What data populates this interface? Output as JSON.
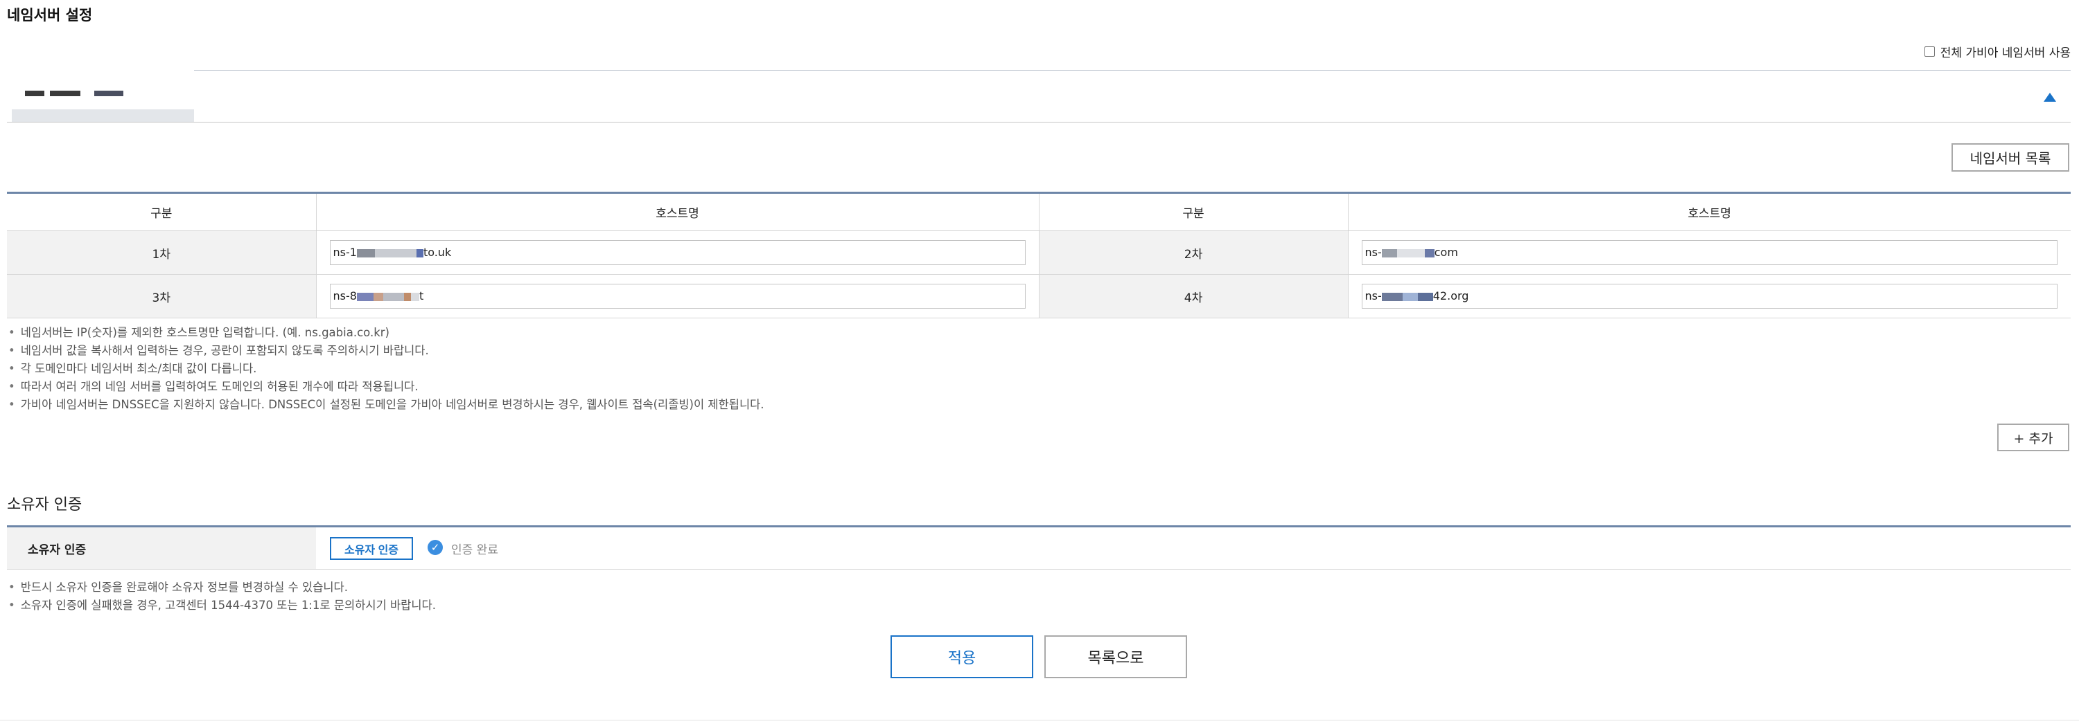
{
  "page": {
    "title": "네임서버 설정"
  },
  "use_all": {
    "label": "전체 가비아 네임서버 사용",
    "checked": false
  },
  "domain_tab": {
    "expanded": true
  },
  "ns_list_button": {
    "label": "네임서버 목록"
  },
  "table": {
    "headers": {
      "col1": "구분",
      "col2": "호스트명",
      "col3": "구분",
      "col4": "호스트명"
    },
    "rows": [
      {
        "left_label": "1차",
        "left_prefix": "ns-1",
        "left_suffix": "to.uk",
        "right_label": "2차",
        "right_prefix": "ns-",
        "right_suffix": "com"
      },
      {
        "left_label": "3차",
        "left_prefix": "ns-8",
        "left_suffix": "t",
        "right_label": "4차",
        "right_prefix": "ns-",
        "right_suffix": "42.org"
      }
    ]
  },
  "notes": [
    "네임서버는 IP(숫자)를 제외한 호스트명만 입력합니다. (예. ns.gabia.co.kr)",
    "네임서버 값을 복사해서 입력하는 경우, 공란이 포함되지 않도록 주의하시기 바랍니다.",
    "각 도메인마다 네임서버 최소/최대 값이 다릅니다.",
    "따라서 여러 개의 네임 서버를 입력하여도 도메인의 허용된 개수에 따라 적용됩니다.",
    "가비아 네임서버는 DNSSEC을 지원하지 않습니다. DNSSEC이 설정된 도메인을 가비아 네임서버로 변경하시는 경우, 웹사이트 접속(리졸빙)이 제한됩니다."
  ],
  "add_button": {
    "label": "+ 추가"
  },
  "owner": {
    "section_title": "소유자 인증",
    "row_label": "소유자 인증",
    "button_label": "소유자 인증",
    "status": "인증 완료",
    "notes": [
      "반드시 소유자 인증을 완료해야 소유자 정보를 변경하실 수 있습니다.",
      "소유자 인증에 실패했을 경우, 고객센터 1544-4370 또는 1:1로 문의하시기 바랍니다."
    ]
  },
  "actions": {
    "apply": "적용",
    "back": "목록으로"
  },
  "colors": {
    "accent": "#1a73c8",
    "header_line": "#6d86a8",
    "label_bg": "#f2f2f2"
  }
}
